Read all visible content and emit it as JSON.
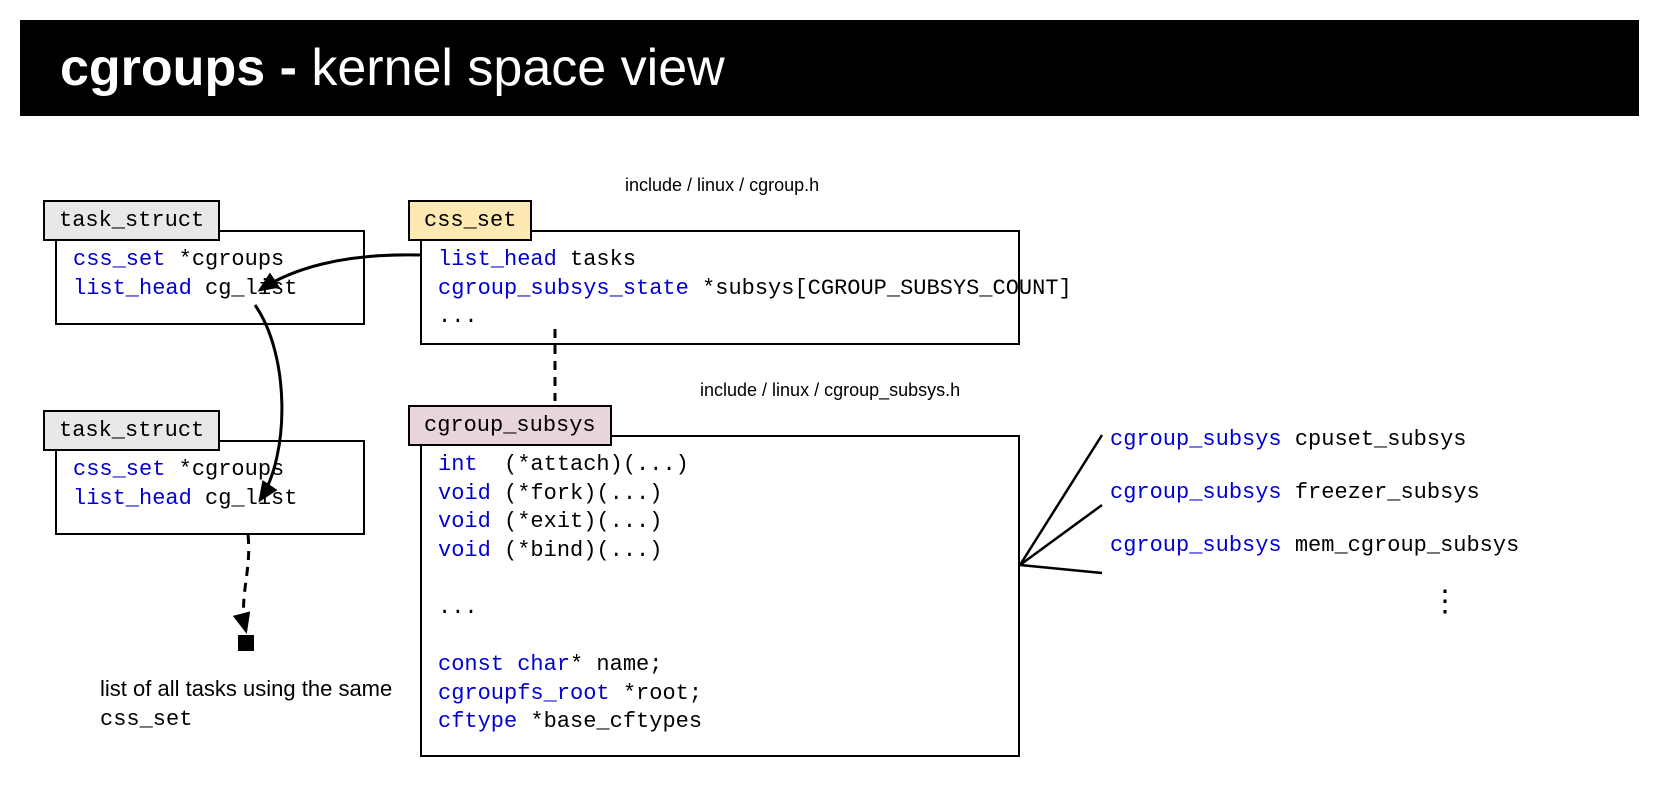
{
  "header": {
    "bold": "cgroups -",
    "rest": " kernel space view"
  },
  "task1": {
    "label": "task_struct",
    "line1_type": "css_set",
    "line1_rest": " *cgroups",
    "line2_type": "list_head",
    "line2_rest": " cg_list"
  },
  "task2": {
    "label": "task_struct",
    "line1_type": "css_set",
    "line1_rest": " *cgroups",
    "line2_type": "list_head",
    "line2_rest": " cg_list"
  },
  "css_set": {
    "label": "css_set",
    "path": "include / linux / cgroup.h",
    "line1_type": "list_head",
    "line1_rest": " tasks",
    "line2_type": "cgroup_subsys_state",
    "line2_rest": " *subsys[CGROUP_SUBSYS_COUNT]",
    "line3": "..."
  },
  "cgroup_subsys": {
    "label": "cgroup_subsys",
    "path": "include / linux / cgroup_subsys.h",
    "lines": [
      {
        "t": "int",
        "r": "  (*attach)(...)"
      },
      {
        "t": "void",
        "r": " (*fork)(...)"
      },
      {
        "t": "void",
        "r": " (*exit)(...)"
      },
      {
        "t": "void",
        "r": " (*bind)(...)"
      }
    ],
    "mid": "...",
    "lines2": [
      {
        "t": "const char",
        "r": "* name;"
      },
      {
        "t": "cgroupfs_root",
        "r": " *root;"
      },
      {
        "t": "cftype",
        "r": " *base_cftypes"
      }
    ]
  },
  "instances": [
    {
      "t": "cgroup_subsys",
      "r": " cpuset_subsys"
    },
    {
      "t": "cgroup_subsys",
      "r": " freezer_subsys"
    },
    {
      "t": "cgroup_subsys",
      "r": " mem_cgroup_subsys"
    }
  ],
  "caption": {
    "text": "list of all tasks using the same ",
    "mono": "css_set"
  }
}
